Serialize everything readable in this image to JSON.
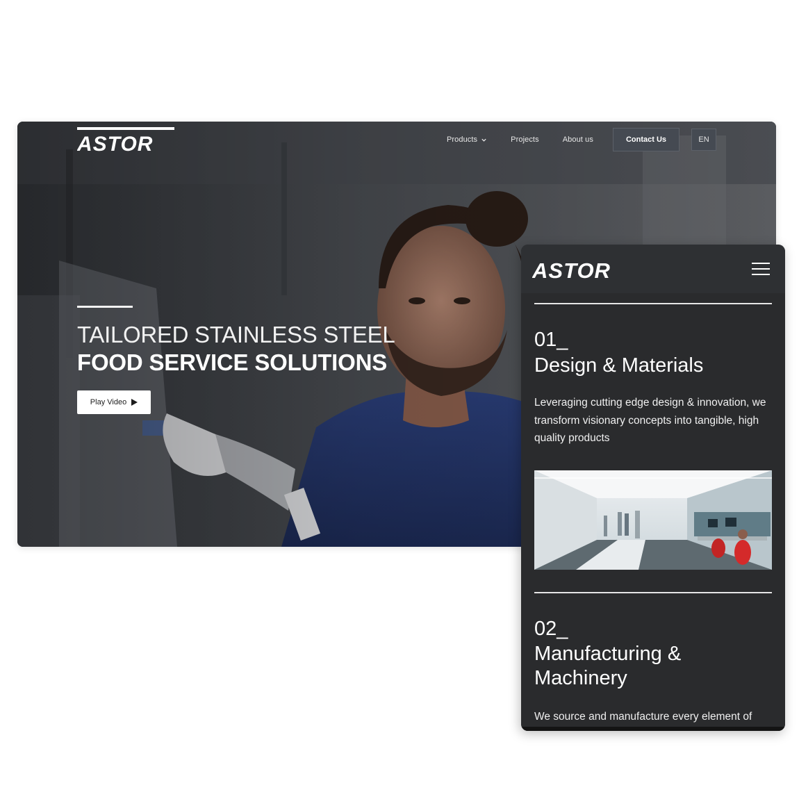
{
  "desktop": {
    "brand": "ASTOR",
    "nav": {
      "products_label": "Products",
      "projects_label": "Projects",
      "about_label": "About us",
      "contact_label": "Contact Us",
      "language_label": "EN"
    },
    "hero": {
      "line1": "TAILORED STAINLESS STEEL",
      "line2": "FOOD SERVICE SOLUTIONS",
      "play_label": "Play Video"
    }
  },
  "mobile": {
    "brand": "ASTOR",
    "sections": [
      {
        "number": "01_",
        "title": "Design & Materials",
        "text": "Leveraging cutting edge design & innovation, we transform visionary concepts into tangible, high quality products"
      },
      {
        "number": "02_",
        "title": "Manufacturing & Machinery",
        "text": "We source and manufacture every element of"
      }
    ]
  },
  "colors": {
    "mobile_background": "#2a2b2d",
    "contact_button": "#454a52",
    "accent_white": "#ffffff"
  }
}
